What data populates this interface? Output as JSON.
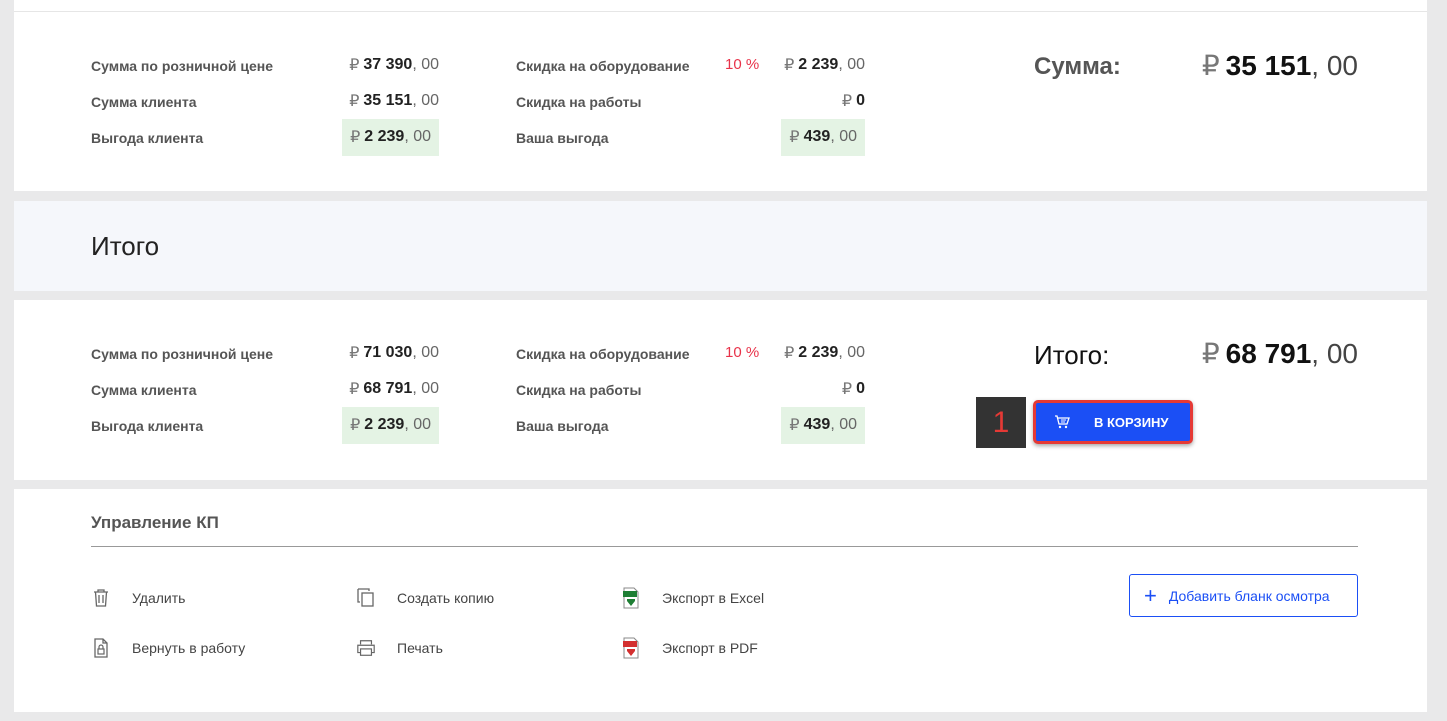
{
  "currency": "₽",
  "sections": {
    "sum": {
      "retail_label": "Сумма по розничной цене",
      "retail_int": "37 390",
      "retail_frac": ", 00",
      "client_label": "Сумма клиента",
      "client_int": "35 151",
      "client_frac": ", 00",
      "benefit_label": "Выгода клиента",
      "benefit_int": "2 239",
      "benefit_frac": ", 00",
      "equip_disc_label": "Скидка на оборудование",
      "equip_disc_pct": "10 %",
      "equip_disc_int": "2 239",
      "equip_disc_frac": ", 00",
      "work_disc_label": "Скидка на работы",
      "work_disc_int": "0",
      "your_benefit_label": "Ваша выгода",
      "your_benefit_int": "439",
      "your_benefit_frac": ", 00",
      "total_label": "Сумма:",
      "total_int": "35 151",
      "total_frac": ", 00"
    },
    "itogo_title": "Итого",
    "itogo": {
      "retail_label": "Сумма по розничной цене",
      "retail_int": "71 030",
      "retail_frac": ", 00",
      "client_label": "Сумма клиента",
      "client_int": "68 791",
      "client_frac": ", 00",
      "benefit_label": "Выгода клиента",
      "benefit_int": "2 239",
      "benefit_frac": ", 00",
      "equip_disc_label": "Скидка на оборудование",
      "equip_disc_pct": "10 %",
      "equip_disc_int": "2 239",
      "equip_disc_frac": ", 00",
      "work_disc_label": "Скидка на работы",
      "work_disc_int": "0",
      "your_benefit_label": "Ваша выгода",
      "your_benefit_int": "439",
      "your_benefit_frac": ", 00",
      "total_label": "Итого:",
      "total_int": "68 791",
      "total_frac": ", 00",
      "step_number": "1",
      "cart_button": "В КОРЗИНУ"
    }
  },
  "manage": {
    "title": "Управление КП",
    "actions": {
      "delete": "Удалить",
      "return": "Вернуть в работу",
      "copy": "Создать копию",
      "print": "Печать",
      "excel": "Экспорт в Excel",
      "pdf": "Экспорт в PDF"
    },
    "add_button": "Добавить бланк осмотра"
  },
  "colors": {
    "accent": "#1b4ff5",
    "discount": "#e8334a",
    "highlight": "#e4f3e4",
    "annotation_border": "#e53935"
  }
}
